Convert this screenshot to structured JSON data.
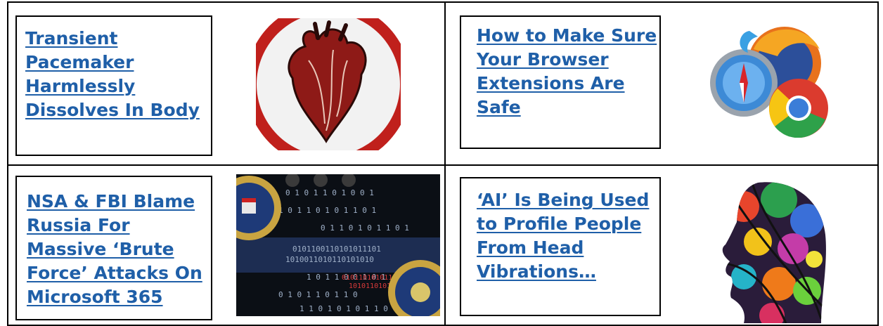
{
  "articles": [
    {
      "title": "Transient Pacemaker Harmlessly Dissolves In Body",
      "lines": [
        "Transient",
        "Pacemaker",
        "Harmlessly",
        "Dissolves In Body"
      ],
      "image_icon": "anatomical-heart-image"
    },
    {
      "title": "How to Make Sure Your Browser Extensions Are Safe",
      "lines": [
        "How to Make Sure",
        "Your Browser",
        "Extensions Are",
        "Safe"
      ],
      "image_icon": "browser-logos-image"
    },
    {
      "title": "NSA & FBI Blame Russia For Massive ‘Brute Force’ Attacks On Microsoft 365",
      "lines": [
        "NSA & FBI Blame",
        "Russia For",
        "Massive ‘Brute",
        "Force’ Attacks On",
        "Microsoft 365"
      ],
      "image_icon": "nsa-fbi-binary-image"
    },
    {
      "title": "‘AI’ Is Being Used to Profile People From Head Vibrations…",
      "lines": [
        "‘AI’ Is Being Used",
        "to Profile People",
        "From Head",
        "Vibrations…"
      ],
      "image_icon": "colorful-head-profile-image"
    }
  ],
  "colors": {
    "link": "#1f5fa8",
    "border": "#000000"
  }
}
